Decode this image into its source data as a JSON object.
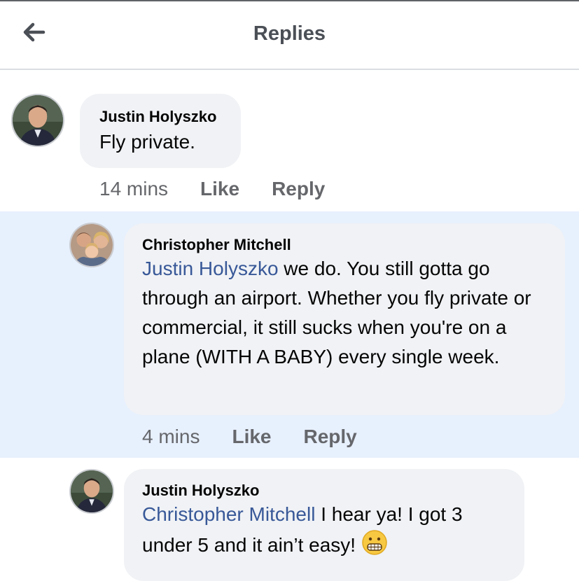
{
  "header": {
    "title": "Replies",
    "back_icon": "arrow-left-icon"
  },
  "comments": [
    {
      "author": "Justin Holyszko",
      "mention": "",
      "text": "Fly private.",
      "time": "14 mins",
      "like_label": "Like",
      "reply_label": "Reply"
    },
    {
      "author": "Christopher Mitchell",
      "mention": "Justin Holyszko",
      "text": " we do. You still gotta go through an airport. Whether you fly private or commercial, it still sucks when you're on a plane (WITH A BABY) every single week.",
      "time": "4 mins",
      "like_label": "Like",
      "reply_label": "Reply"
    },
    {
      "author": "Justin Holyszko",
      "mention": "Christopher Mitchell",
      "text": " I hear ya! I got 3 under 5 and it ain’t easy!",
      "emoji": "grimacing-face-emoji"
    }
  ],
  "colors": {
    "highlight_background": "#e7f0fd",
    "bubble": "#f0f2f5",
    "mention": "#385898",
    "meta": "#65676b"
  }
}
